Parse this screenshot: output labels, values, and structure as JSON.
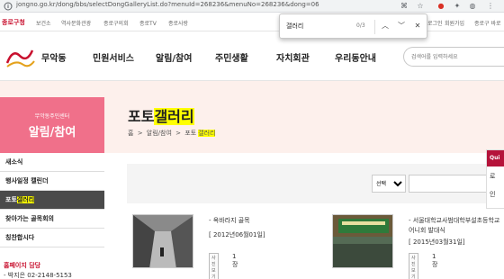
{
  "browser": {
    "url": "jongno.go.kr/dong/bbs/selectDongGalleryList.do?menuId=268236&menuNo=268236&dong=06"
  },
  "findbar": {
    "query": "갤러리",
    "count": "0/3"
  },
  "govbar": {
    "logo": "종로구청",
    "links": [
      "보건소",
      "역사문화관광",
      "종로구의회",
      "종로TV",
      "종로사랑"
    ],
    "util": [
      "로그인",
      "회원가입",
      "종로구 바로"
    ]
  },
  "header": {
    "brand": "무악동",
    "nav": [
      "민원서비스",
      "알림/참여",
      "주민생활",
      "자치회관",
      "우리동안내"
    ],
    "search_placeholder": "검색어를 입력하세요"
  },
  "banner": {
    "side_sub": "무악동주민센터",
    "side_main": "알림/참여",
    "title_plain": "포토",
    "title_hl": "갤러리",
    "crumbs": [
      "홈",
      ">",
      "알림/참여",
      ">",
      "포토"
    ],
    "crumb_hl": "갤러리"
  },
  "sidemenu": {
    "items": [
      "새소식",
      "행사일정 캘린더",
      "포토",
      "찾아가는 골목회의",
      "칭찬합시다"
    ],
    "active_hl": "갤러리",
    "contact_title": "홈페이지 담당",
    "contact_line": "- 박지은 02-2148-5153"
  },
  "filter": {
    "select_label": "선택"
  },
  "gallery": [
    {
      "title": "- 옥바라지 골목",
      "date": "[ 2012년06월01일]",
      "badge": "사진보기",
      "count": "1장"
    },
    {
      "title": "- 서울대학교사범대학부설초등학교 어니회 발대식",
      "date": "[ 2015년03월31일]",
      "badge": "사진보기",
      "count": "1장"
    }
  ],
  "quick": {
    "head": "Qui",
    "items": [
      "로",
      "인"
    ]
  },
  "colors": {
    "accent": "#c8102e",
    "side_head": "#f0708a",
    "banner_bg": "#fdf0ec",
    "highlight": "#ffff00",
    "active_menu": "#4a4a4a"
  }
}
